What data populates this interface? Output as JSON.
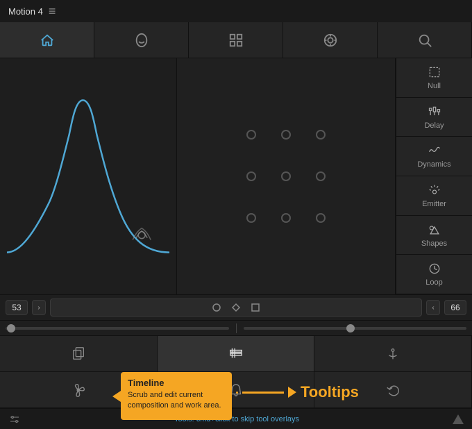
{
  "titleBar": {
    "appName": "Motion 4",
    "menuIcon": "≡"
  },
  "tabs": [
    {
      "id": "home",
      "label": "Home",
      "icon": "home",
      "active": true
    },
    {
      "id": "mask",
      "label": "Mask",
      "icon": "mask",
      "active": false
    },
    {
      "id": "grid",
      "label": "Grid",
      "icon": "grid",
      "active": false
    },
    {
      "id": "target",
      "label": "Target",
      "icon": "target",
      "active": false
    },
    {
      "id": "search",
      "label": "Search",
      "icon": "search",
      "active": false
    }
  ],
  "sidebar": {
    "items": [
      {
        "id": "null",
        "label": "Null",
        "icon": "null"
      },
      {
        "id": "delay",
        "label": "Delay",
        "icon": "delay"
      },
      {
        "id": "dynamics",
        "label": "Dynamics",
        "icon": "dynamics"
      },
      {
        "id": "emitter",
        "label": "Emitter",
        "icon": "emitter"
      },
      {
        "id": "shapes",
        "label": "Shapes",
        "icon": "shapes"
      },
      {
        "id": "loop",
        "label": "Loop",
        "icon": "loop"
      }
    ]
  },
  "controls": {
    "leftValue": "53",
    "rightValue": "66",
    "shapes": [
      "circle",
      "diamond",
      "square"
    ]
  },
  "toolbars": {
    "row1": [
      {
        "id": "copy",
        "icon": "copy"
      },
      {
        "id": "timeline",
        "icon": "timeline",
        "active": true
      },
      {
        "id": "anchor",
        "icon": "anchor"
      }
    ],
    "row2": [
      {
        "id": "fan",
        "icon": "fan"
      },
      {
        "id": "bell",
        "icon": "bell"
      },
      {
        "id": "undo",
        "icon": "undo"
      }
    ]
  },
  "tooltip": {
    "title": "Timeline",
    "description": "Scrub and edit current composition and work area.",
    "arrowLabel": "Tooltips"
  },
  "statusBar": {
    "leftIcon": "settings-sliders",
    "text": "Tools: ",
    "shortcut": "cmd+click",
    "textAfter": " to skip tool overlays"
  }
}
